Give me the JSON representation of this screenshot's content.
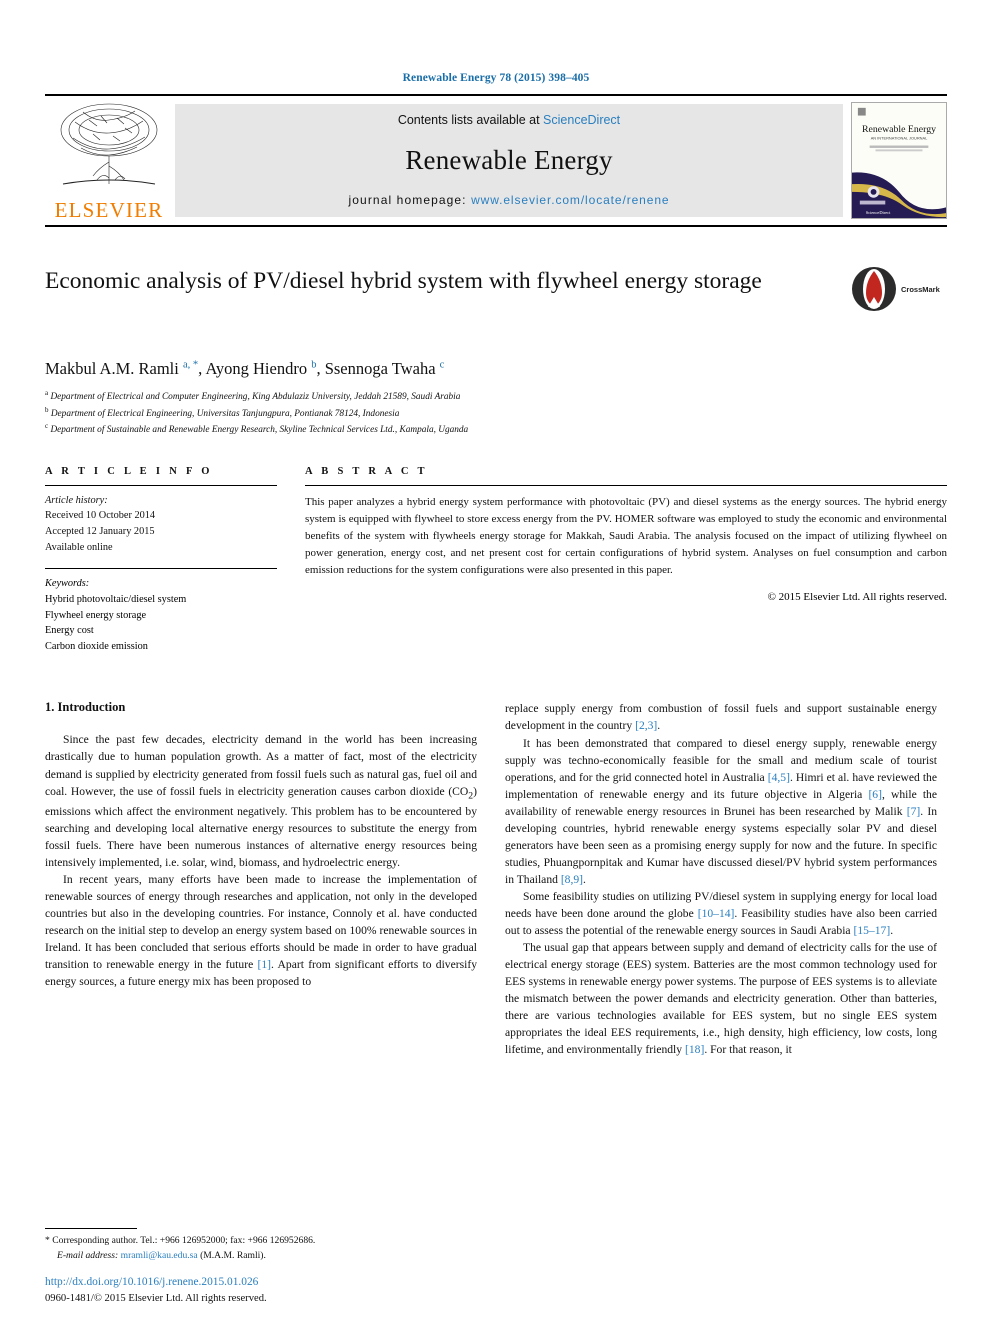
{
  "running_head": "Renewable Energy 78 (2015) 398–405",
  "masthead": {
    "publisher_name": "ELSEVIER",
    "contents_prefix": "Contents lists available at ",
    "contents_link": "ScienceDirect",
    "journal_title": "Renewable Energy",
    "homepage_prefix": "journal homepage: ",
    "homepage_url": "www.elsevier.com/locate/renene",
    "cover_title": "Renewable Energy",
    "cover_subtitle": "AN INTERNATIONAL JOURNAL"
  },
  "article": {
    "title": "Economic analysis of PV/diesel hybrid system with flywheel energy storage",
    "crossmark_label": "CrossMark",
    "authors_html": "Makbul A.M. Ramli <sup>a, *</sup>, Ayong Hiendro <sup>b</sup>, Ssennoga Twaha <sup>c</sup>",
    "affiliations": [
      "Department of Electrical and Computer Engineering, King Abdulaziz University, Jeddah 21589, Saudi Arabia",
      "Department of Electrical Engineering, Universitas Tanjungpura, Pontianak 78124, Indonesia",
      "Department of Sustainable and Renewable Energy Research, Skyline Technical Services Ltd., Kampala, Uganda"
    ],
    "affiliation_markers": [
      "a",
      "b",
      "c"
    ]
  },
  "info": {
    "heading": "A R T I C L E  I N F O",
    "history_label": "Article history:",
    "history": [
      "Received 10 October 2014",
      "Accepted 12 January 2015",
      "Available online"
    ],
    "keywords_label": "Keywords:",
    "keywords": [
      "Hybrid photovoltaic/diesel system",
      "Flywheel energy storage",
      "Energy cost",
      "Carbon dioxide emission"
    ]
  },
  "abstract": {
    "heading": "A B S T R A C T",
    "text": "This paper analyzes a hybrid energy system performance with photovoltaic (PV) and diesel systems as the energy sources. The hybrid energy system is equipped with flywheel to store excess energy from the PV. HOMER software was employed to study the economic and environmental benefits of the system with flywheels energy storage for Makkah, Saudi Arabia. The analysis focused on the impact of utilizing flywheel on power generation, energy cost, and net present cost for certain configurations of hybrid system. Analyses on fuel consumption and carbon emission reductions for the system configurations were also presented in this paper.",
    "copyright": "© 2015 Elsevier Ltd. All rights reserved."
  },
  "body": {
    "section_number_title": "1. Introduction",
    "left_paragraphs": [
      "Since the past few decades, electricity demand in the world has been increasing drastically due to human population growth. As a matter of fact, most of the electricity demand is supplied by electricity generated from fossil fuels such as natural gas, fuel oil and coal. However, the use of fossil fuels in electricity generation causes carbon dioxide (CO2) emissions which affect the environment negatively. This problem has to be encountered by searching and developing local alternative energy resources to substitute the energy from fossil fuels. There have been numerous instances of alternative energy resources being intensively implemented, i.e. solar, wind, biomass, and hydroelectric energy.",
      "In recent years, many efforts have been made to increase the implementation of renewable sources of energy through researches and application, not only in the developed countries but also in the developing countries. For instance, Connoly et al. have conducted research on the initial step to develop an energy system based on 100% renewable sources in Ireland. It has been concluded that serious efforts should be made in order to have gradual transition to renewable energy in the future [1]. Apart from significant efforts to diversify energy sources, a future energy mix has been proposed to"
    ],
    "right_paragraphs": [
      "replace supply energy from combustion of fossil fuels and support sustainable energy development in the country [2,3].",
      "It has been demonstrated that compared to diesel energy supply, renewable energy supply was techno-economically feasible for the small and medium scale of tourist operations, and for the grid connected hotel in Australia [4,5]. Himri et al. have reviewed the implementation of renewable energy and its future objective in Algeria [6], while the availability of renewable energy resources in Brunei has been researched by Malik [7]. In developing countries, hybrid renewable energy systems especially solar PV and diesel generators have been seen as a promising energy supply for now and the future. In specific studies, Phuangpornpitak and Kumar have discussed diesel/PV hybrid system performances in Thailand [8,9].",
      "Some feasibility studies on utilizing PV/diesel system in supplying energy for local load needs have been done around the globe [10–14]. Feasibility studies have also been carried out to assess the potential of the renewable energy sources in Saudi Arabia [15–17].",
      "The usual gap that appears between supply and demand of electricity calls for the use of electrical energy storage (EES) system. Batteries are the most common technology used for EES systems in renewable energy power systems. The purpose of EES systems is to alleviate the mismatch between the power demands and electricity generation. Other than batteries, there are various technologies available for EES system, but no single EES system appropriates the ideal EES requirements, i.e., high density, high efficiency, low costs, long lifetime, and environmentally friendly [18]. For that reason, it"
    ]
  },
  "footnote": {
    "corresponding": "* Corresponding author. Tel.: +966 126952000; fax: +966 126952686.",
    "email_label": "E-mail address:",
    "email": "mramli@kau.edu.sa",
    "email_suffix": "(M.A.M. Ramli).",
    "doi": "http://dx.doi.org/10.1016/j.renene.2015.01.026",
    "issn": "0960-1481/© 2015 Elsevier Ltd. All rights reserved."
  },
  "colors": {
    "link_blue": "#2a7fc0",
    "header_blue": "#1a6ea8",
    "elsevier_orange": "#f07d00",
    "band_gray": "#e6e6e6"
  }
}
